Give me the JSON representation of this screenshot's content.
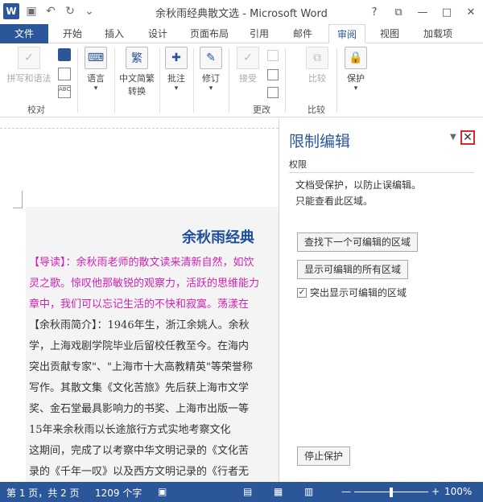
{
  "window": {
    "title": "余秋雨经典散文选 - Microsoft Word",
    "help": "?",
    "restore": "⧉",
    "minimize": "—",
    "maximize": "□",
    "close": "✕"
  },
  "tabs": [
    {
      "label": "文件"
    },
    {
      "label": "开始"
    },
    {
      "label": "插入"
    },
    {
      "label": "设计"
    },
    {
      "label": "页面布局"
    },
    {
      "label": "引用"
    },
    {
      "label": "邮件"
    },
    {
      "label": "审阅"
    },
    {
      "label": "视图"
    },
    {
      "label": "加载项"
    }
  ],
  "ribbon": {
    "proofing_label": "拼写和语法",
    "language": "语言",
    "convert": "中文简繁\n转换",
    "comment": "批注",
    "revise": "修订",
    "accept": "接受",
    "compare": "比较",
    "protect": "保护",
    "groups": {
      "proofing": "校对",
      "changes": "更改",
      "compare": "比较"
    }
  },
  "document": {
    "heading": "余秋雨经典",
    "lines": [
      {
        "text": "【导读】：余秋雨老师的散文读来清新自然，如饮",
        "pink": true
      },
      {
        "text": "灵之歌。惊叹他那敏锐的观察力，活跃的思维能力",
        "pink": true
      },
      {
        "text": "章中，我们可以忘记生活的不快和寂寞。荡漾在",
        "pink": true
      },
      {
        "text": "【余秋雨简介】：1946年生，浙江余姚人。余秋",
        "pink": false
      },
      {
        "text": "学，上海戏剧学院毕业后留校任教至今。在海内",
        "pink": false
      },
      {
        "text": "突出贡献专家\"、\"上海市十大高教精英\"等荣誉称",
        "pink": false
      },
      {
        "text": "写作。其散文集《文化苦旅》先后获上海市文学",
        "pink": false
      },
      {
        "text": "奖、金石堂最具影响力的书奖、上海市出版一等",
        "pink": false
      },
      {
        "text": "    15年来余秋雨以长途旅行方式实地考察文化",
        "pink": false
      },
      {
        "text": "这期间，完成了以考察中华文明记录的《文化苦",
        "pink": false
      },
      {
        "text": "录的《千年一叹》以及西方文明记录的《行者无",
        "pink": false
      }
    ]
  },
  "panel": {
    "title": "限制编辑",
    "section": "权限",
    "line1": "文档受保护，以防止误编辑。",
    "line2": "只能查看此区域。",
    "btn_next": "查找下一个可编辑的区域",
    "btn_all": "显示可编辑的所有区域",
    "check_label": "突出显示可编辑的区域",
    "check_mark": "✓",
    "btn_stop": "停止保护"
  },
  "status": {
    "page": "第 1 页，共 2 页",
    "words": "1209 个字",
    "zoom": "100%"
  }
}
